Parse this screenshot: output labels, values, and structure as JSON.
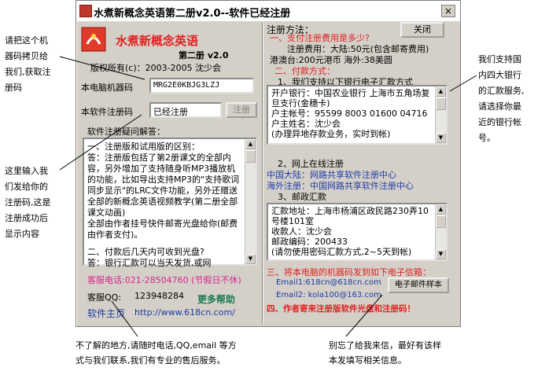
{
  "window": {
    "title": "水煮新概念英语第二册v2.0--软件已经注册",
    "close_glyph": "×"
  },
  "left": {
    "app_title": "水煮新概念英语",
    "edition": "第二册 v2.0",
    "copyright": "版权所有(c)：2003-2005 沈少会",
    "machine_code_label": "本电脑机器码",
    "machine_code_value": "MRG2E0KBJG3LZJ",
    "reg_code_label": "本软件注册码",
    "reg_code_value": "已经注册",
    "register_button": "注册",
    "faq_label": "软件注册疑问解答：",
    "faq_text_1": "一、注册版和试用版的区别：",
    "faq_text_2": "答：注册版包括了第2册课文的全部内容，另外增加了支持随身听MP3播放机的功能，比如导出支持MP3的\"支持歌词同步显示\"的LRC文件功能，另外还赠送全部的新概念英语视频教学(第二册全部课文动画)",
    "faq_text_3": "全部由作者挂号快件邮寄光盘给你(邮费由作者支付)。",
    "faq_text_4": "二、付款后几天内可收到光盘?",
    "faq_text_5": "答：银行汇款可以当天发货,或网",
    "service_phone": "客服电话:021-28504760 (节假日不休)",
    "service_qq_label": "客服QQ:",
    "service_qq_value": "123948284",
    "more_help": "更多帮助",
    "homepage_label": "软件主页",
    "homepage_url": "http://www.618cn.com/"
  },
  "right": {
    "header": "注册方法：",
    "close_button": "关闭",
    "q1": "一、支付注册费用是多少?",
    "fee_line1": "注册费用：大陆:50元(包含邮寄费用)",
    "fee_line2": "港澳台:200元港币  海外:38美圆",
    "q2": "二、付款方式：",
    "bank_heading": "1、我们支持以下银行电子汇款方式",
    "bank_lines": [
      "开户银行：中国农业银行 上海市五角场复旦支行(金穗卡)",
      "户主帐号：95599 8003 01600 04716",
      "户主姓名：沈少会",
      "(办理异地存款业务，实时到帐)"
    ],
    "online_heading": "2、网上在线注册",
    "online_cn": "中国大陆：网路共享软件注册中心",
    "online_overseas": "海外注册：中国网路共享软件注册中心",
    "postal_heading": "3、邮政汇款",
    "postal_lines": [
      "汇款地址：上海市杨浦区政民路230弄10号楼101室",
      "收款人：沈少会",
      "邮政编码：200433",
      "(请勿使用密码汇款方式,2~5天到帐)"
    ],
    "send_code": "三、将本电脑的机器码发到如下电子信箱：",
    "email1": "Email1:618cn@618cn.com",
    "email2": "Email2: kola100@163.com",
    "email_sample_button": "电子邮件样本",
    "step4": "四、作者寄来注册版软件光盘和注册码！"
  },
  "annotations": {
    "a1": [
      "请把这个机",
      "器码拷贝给",
      "我们,获取注",
      "册码"
    ],
    "a2": [
      "这里输入我",
      "们发给你的",
      "注册码,这是",
      "注册成功后",
      "显示内容"
    ],
    "a3": [
      "我们支持国",
      "内四大银行",
      "的汇款服务,",
      "请选择你最",
      "近的银行帐",
      "号。"
    ],
    "a4": [
      "不了解的地方,请随时电话,QQ,email  等方",
      "式与我们联系,我们有专业的售后服务。"
    ],
    "a5": [
      "别忘了给我来信，最好有该样",
      "本发填写相关信息。"
    ]
  }
}
